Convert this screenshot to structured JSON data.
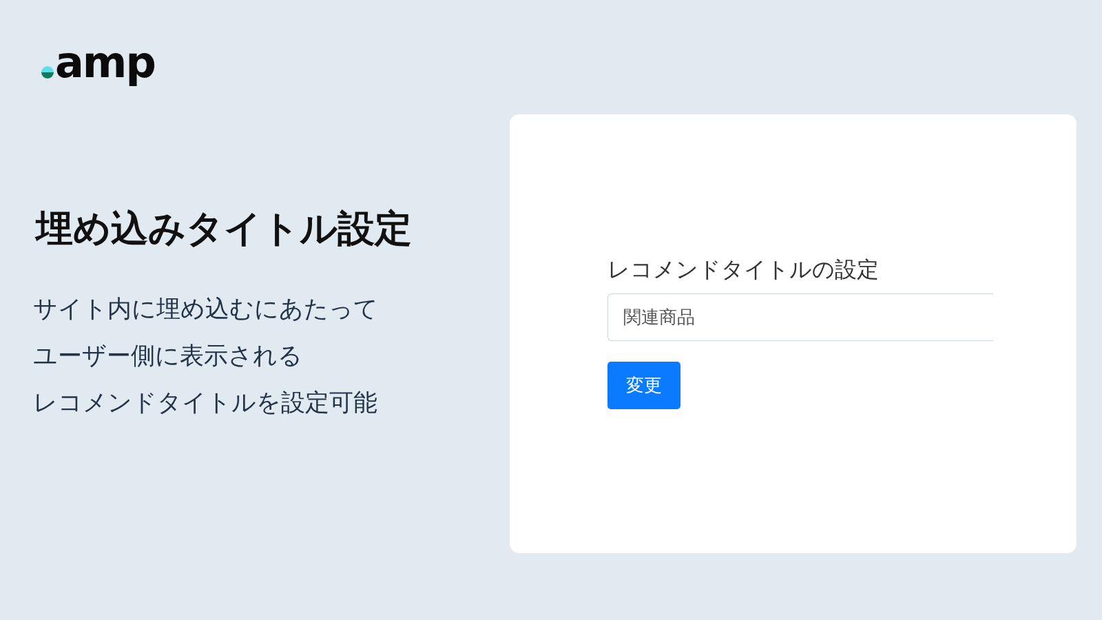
{
  "logo": {
    "text": "amp"
  },
  "heading": "埋め込みタイトル設定",
  "description": [
    "サイト内に埋め込むにあたって",
    "ユーザー側に表示される",
    "レコメンドタイトルを設定可能"
  ],
  "form": {
    "label": "レコメンドタイトルの設定",
    "value": "関連商品",
    "button": "変更"
  }
}
